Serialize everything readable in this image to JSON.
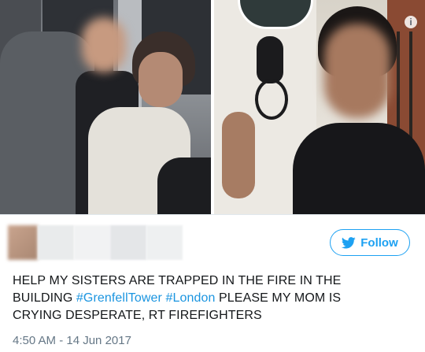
{
  "follow_button": {
    "label": "Follow",
    "icon": "twitter-bird-icon",
    "color": "#1da1f2"
  },
  "tweet": {
    "text_parts": [
      {
        "text": "HELP MY SISTERS ARE TRAPPED IN THE FIRE IN THE BUILDING ",
        "type": "text"
      },
      {
        "text": "#GrenfellTower",
        "type": "hashtag"
      },
      {
        "text": " ",
        "type": "text"
      },
      {
        "text": "#London",
        "type": "hashtag"
      },
      {
        "text": " PLEASE MY MOM IS CRYING DESPERATE, RT FIREFIGHTERS",
        "type": "text"
      }
    ],
    "hashtag_color": "#1b95e0",
    "timestamp": "4:50 AM - 14 Jun 2017"
  },
  "media": {
    "info_icon": "info-icon"
  }
}
